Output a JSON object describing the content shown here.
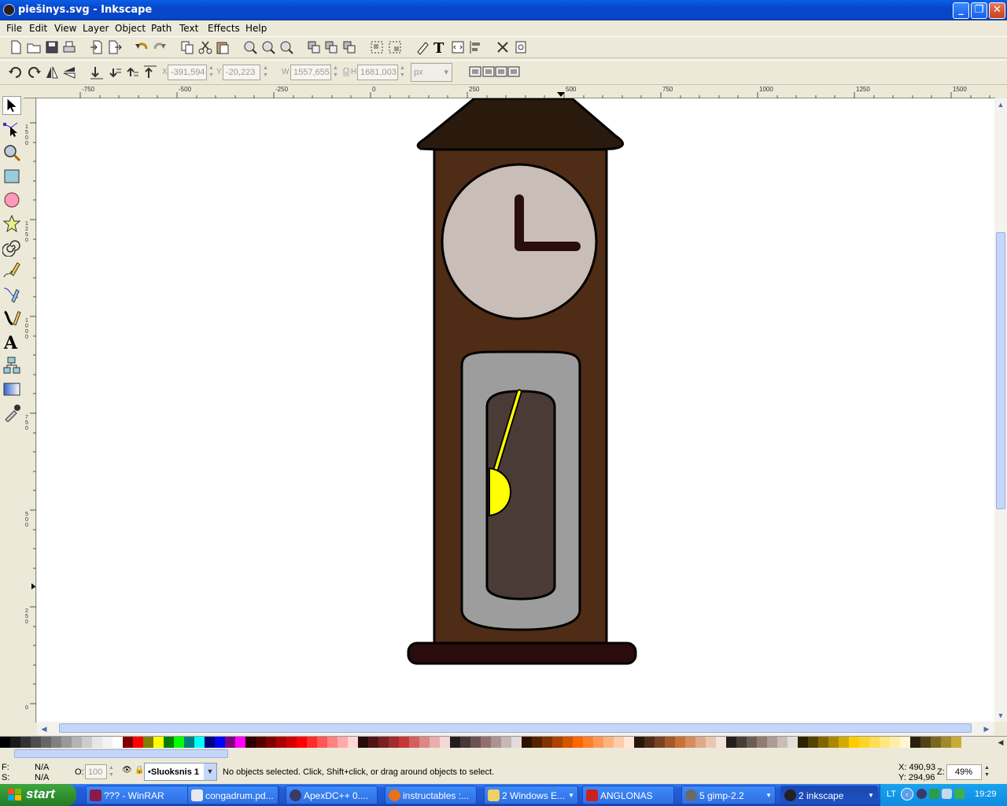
{
  "window": {
    "title": "piešinys.svg - Inkscape"
  },
  "menu": [
    "File",
    "Edit",
    "View",
    "Layer",
    "Object",
    "Path",
    "Text",
    "Effects",
    "Help"
  ],
  "toolbar2": {
    "x_label": "X",
    "x_value": "-391,594",
    "y_label": "Y",
    "y_value": "-20,223",
    "w_label": "W",
    "w_value": "1557,655",
    "h_label": "H",
    "h_value": "1681,003",
    "unit": "px"
  },
  "ruler": {
    "h_ticks": [
      "-750",
      "-500",
      "-250",
      "0",
      "250",
      "500",
      "750",
      "1000",
      "1250",
      "1500"
    ],
    "v_ticks": [
      "1500",
      "1250",
      "1000",
      "750",
      "500",
      "250",
      "0"
    ]
  },
  "drawing": {
    "colors": {
      "roof": "#2a1a0e",
      "case": "#4f2c15",
      "clock_face": "#c9bdb7",
      "hands": "#2a0d0d",
      "door": "#9d9d9d",
      "window": "#4a3b36",
      "pendulum": "#ffff00",
      "base": "#2b0c0c"
    }
  },
  "palette_colors": [
    "#000000",
    "#1a1a1a",
    "#333333",
    "#4d4d4d",
    "#666666",
    "#808080",
    "#999999",
    "#b3b3b3",
    "#cccccc",
    "#e6e6e6",
    "#f2f2f2",
    "#ffffff",
    "#800000",
    "#ff0000",
    "#808000",
    "#ffff00",
    "#008000",
    "#00ff00",
    "#008080",
    "#00ffff",
    "#000080",
    "#0000ff",
    "#800080",
    "#ff00ff",
    "#2b0000",
    "#550000",
    "#800000",
    "#aa0000",
    "#d40000",
    "#ff0000",
    "#ff2a2a",
    "#ff5555",
    "#ff8080",
    "#ffaaaa",
    "#ffd5d5",
    "#280b0b",
    "#501616",
    "#782121",
    "#a02c2c",
    "#c83737",
    "#d35f5f",
    "#de8787",
    "#e9afaf",
    "#f4d7d7",
    "#241c1c",
    "#483737",
    "#6c5353",
    "#916f6f",
    "#ac9393",
    "#c8b7b7",
    "#e3dbdb",
    "#2b1100",
    "#552200",
    "#803300",
    "#aa4400",
    "#d45500",
    "#ff6600",
    "#ff7f2a",
    "#ff9955",
    "#ffb380",
    "#ffccaa",
    "#ffe6d5",
    "#28170b",
    "#502d16",
    "#784421",
    "#a05a2c",
    "#c87137",
    "#d38d5f",
    "#deaa87",
    "#e9c6af",
    "#f4e3d7",
    "#241f1c",
    "#483e37",
    "#6c5d53",
    "#917c6f",
    "#ac9d93",
    "#c8beb7",
    "#e3dedb",
    "#2b2200",
    "#554400",
    "#806600",
    "#aa8800",
    "#d4aa00",
    "#ffcc00",
    "#ffd42a",
    "#ffdd55",
    "#ffe680",
    "#ffeeaa",
    "#fff6d5",
    "#28220b",
    "#504416",
    "#786721",
    "#a0892c",
    "#c8ab37"
  ],
  "status": {
    "fill_label": "F:",
    "fill_value": "N/A",
    "stroke_label": "S:",
    "stroke_value": "N/A",
    "opacity_label": "O:",
    "opacity_value": "100",
    "layer": "•Sluoksnis 1",
    "message": "No objects selected. Click, Shift+click, or drag around objects to select.",
    "cursor_x": "X: 490,93",
    "cursor_y": "Y: 294,96",
    "zoom_label": "Z:",
    "zoom": "49%"
  },
  "taskbar": {
    "start": "start",
    "tasks": [
      {
        "label": "??? - WinRAR",
        "color": "#8b1a4a"
      },
      {
        "label": "congadrum.pd...",
        "color": "#e8e8f0"
      },
      {
        "label": "ApexDC++ 0....",
        "color": "#3a3a6a"
      },
      {
        "label": "instructables :...",
        "color": "#e8711c"
      },
      {
        "label": "2 Windows E...",
        "color": "#f0d060"
      },
      {
        "label": "ANGLONAS",
        "color": "#cc2020"
      },
      {
        "label": "5 gimp-2.2",
        "color": "#6a6a6a"
      },
      {
        "label": "2 inkscape",
        "color": "#222222"
      }
    ],
    "lang": "LT",
    "clock": "19:29"
  }
}
